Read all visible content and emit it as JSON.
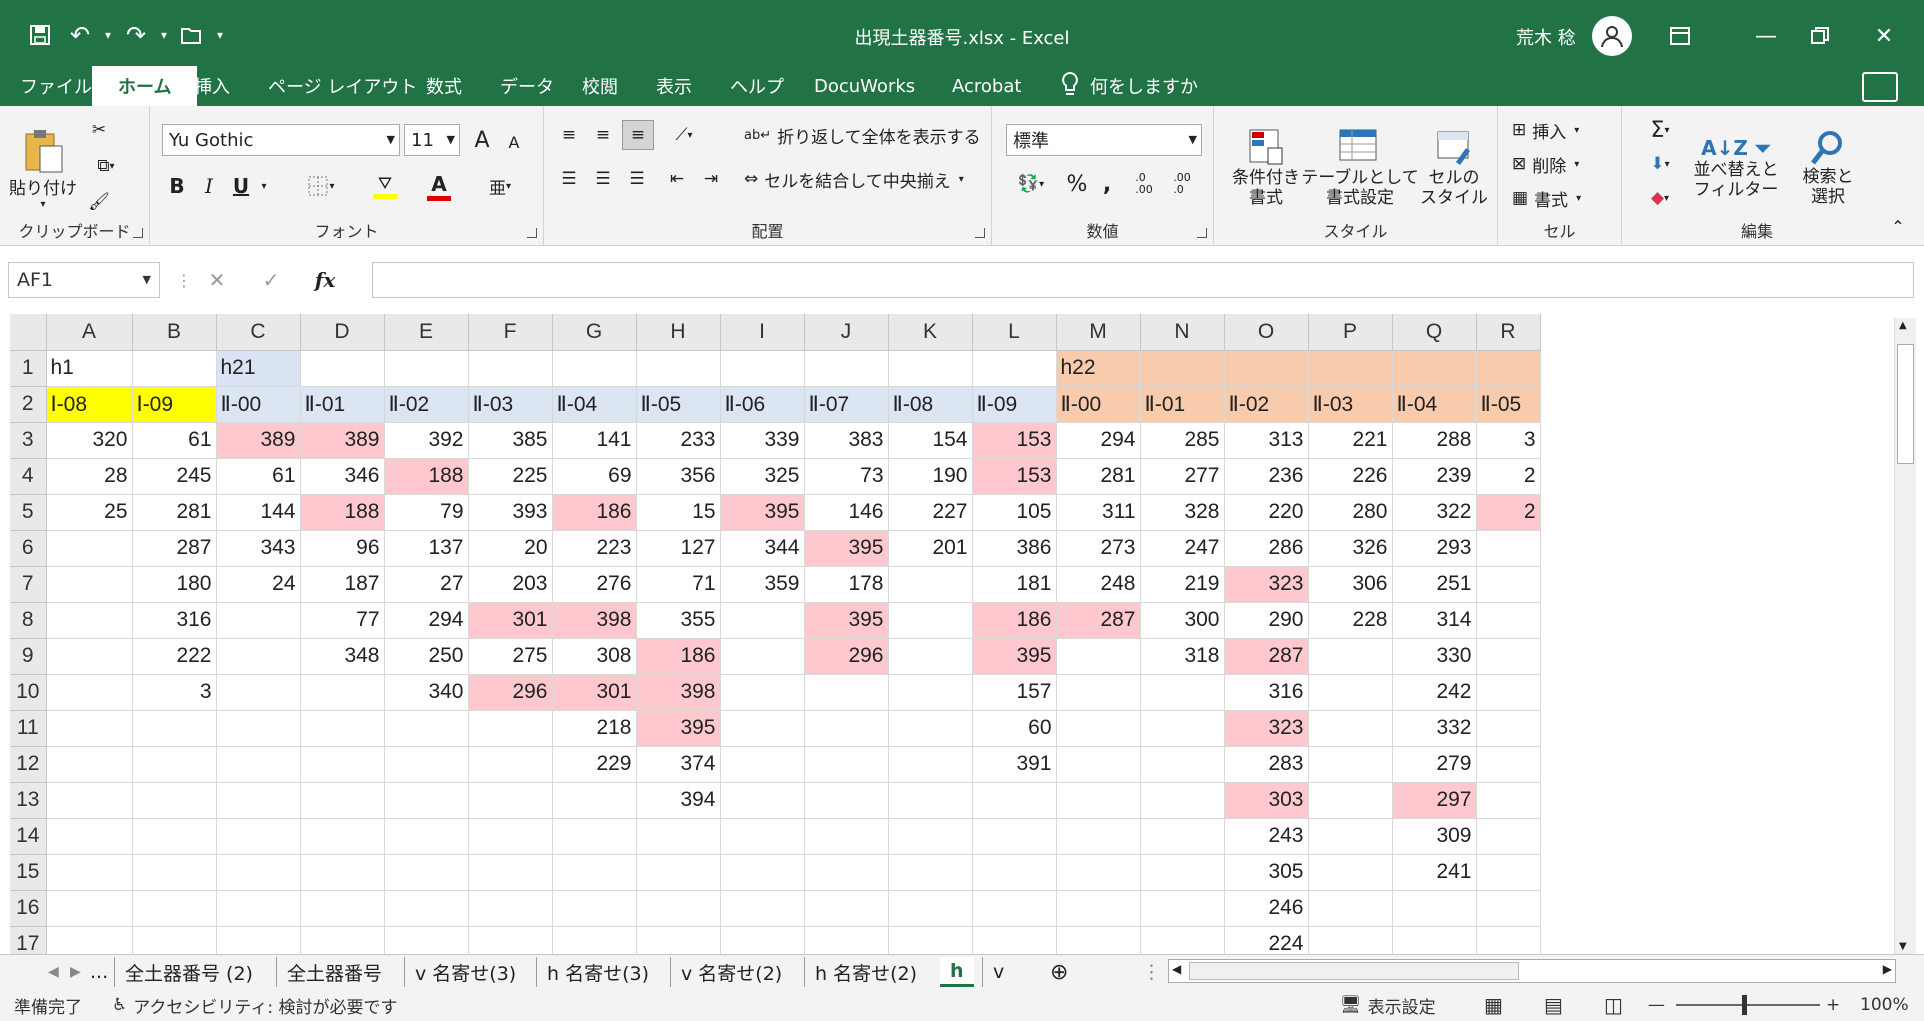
{
  "window": {
    "title": "出現土器番号.xlsx  -  Excel",
    "user": "荒木 稔"
  },
  "tabs": [
    "ファイル",
    "ホーム",
    "挿入",
    "ページ レイアウト",
    "数式",
    "データ",
    "校閲",
    "表示",
    "ヘルプ",
    "DocuWorks",
    "Acrobat"
  ],
  "tell_me": "何をしますか",
  "ribbon": {
    "clipboard": {
      "label": "クリップボード",
      "paste": "貼り付け"
    },
    "font": {
      "label": "フォント",
      "name": "Yu Gothic",
      "size": "11",
      "bold": "B",
      "italic": "I",
      "underline": "U",
      "grow": "A",
      "shrink": "A",
      "color": "A"
    },
    "alignment": {
      "label": "配置",
      "wrap": "折り返して全体を表示する",
      "merge": "セルを結合して中央揃え"
    },
    "number": {
      "label": "数値",
      "format": "標準",
      "percent": "%",
      "comma": ",",
      "inc": ".0\n.00",
      "dec": ".00\n.0"
    },
    "styles": {
      "label": "スタイル",
      "conditional": "条件付き\n書式",
      "table": "テーブルとして\n書式設定",
      "cell": "セルの\nスタイル"
    },
    "cells": {
      "label": "セル",
      "insert": "挿入",
      "delete": "削除",
      "format": "書式"
    },
    "editing": {
      "label": "編集",
      "sort": "並べ替えと\nフィルター",
      "find": "検索と\n選択",
      "sum": "Σ"
    }
  },
  "formula_bar": {
    "name_box": "AF1",
    "formula": ""
  },
  "columns": [
    "A",
    "B",
    "C",
    "D",
    "E",
    "F",
    "G",
    "H",
    "I",
    "J",
    "K",
    "L",
    "M",
    "N",
    "O",
    "P",
    "Q",
    "R"
  ],
  "rows": [
    {
      "n": "1",
      "c": [
        "h1",
        "",
        "h21",
        "",
        "",
        "",
        "",
        "",
        "",
        "",
        "",
        "",
        "h22",
        "",
        "",
        "",
        "",
        ""
      ]
    },
    {
      "n": "2",
      "c": [
        "Ⅰ-08",
        "Ⅰ-09",
        "Ⅱ-00",
        "Ⅱ-01",
        "Ⅱ-02",
        "Ⅱ-03",
        "Ⅱ-04",
        "Ⅱ-05",
        "Ⅱ-06",
        "Ⅱ-07",
        "Ⅱ-08",
        "Ⅱ-09",
        "Ⅱ-00",
        "Ⅱ-01",
        "Ⅱ-02",
        "Ⅱ-03",
        "Ⅱ-04",
        "Ⅱ-05"
      ]
    },
    {
      "n": "3",
      "c": [
        "320",
        "61",
        "389",
        "389",
        "392",
        "385",
        "141",
        "233",
        "339",
        "383",
        "154",
        "153",
        "294",
        "285",
        "313",
        "221",
        "288",
        "3"
      ]
    },
    {
      "n": "4",
      "c": [
        "28",
        "245",
        "61",
        "346",
        "188",
        "225",
        "69",
        "356",
        "325",
        "73",
        "190",
        "153",
        "281",
        "277",
        "236",
        "226",
        "239",
        "2"
      ]
    },
    {
      "n": "5",
      "c": [
        "25",
        "281",
        "144",
        "188",
        "79",
        "393",
        "186",
        "15",
        "395",
        "146",
        "227",
        "105",
        "311",
        "328",
        "220",
        "280",
        "322",
        "2"
      ]
    },
    {
      "n": "6",
      "c": [
        "",
        "287",
        "343",
        "96",
        "137",
        "20",
        "223",
        "127",
        "344",
        "395",
        "201",
        "386",
        "273",
        "247",
        "286",
        "326",
        "293",
        ""
      ]
    },
    {
      "n": "7",
      "c": [
        "",
        "180",
        "24",
        "187",
        "27",
        "203",
        "276",
        "71",
        "359",
        "178",
        "",
        "181",
        "248",
        "219",
        "323",
        "306",
        "251",
        ""
      ]
    },
    {
      "n": "8",
      "c": [
        "",
        "316",
        "",
        "77",
        "294",
        "301",
        "398",
        "355",
        "",
        "395",
        "",
        "186",
        "287",
        "300",
        "290",
        "228",
        "314",
        ""
      ]
    },
    {
      "n": "9",
      "c": [
        "",
        "222",
        "",
        "348",
        "250",
        "275",
        "308",
        "186",
        "",
        "296",
        "",
        "395",
        "",
        "318",
        "287",
        "",
        "330",
        ""
      ]
    },
    {
      "n": "10",
      "c": [
        "",
        "3",
        "",
        "",
        "340",
        "296",
        "301",
        "398",
        "",
        "",
        "",
        "157",
        "",
        "",
        "316",
        "",
        "242",
        ""
      ]
    },
    {
      "n": "11",
      "c": [
        "",
        "",
        "",
        "",
        "",
        "",
        "218",
        "395",
        "",
        "",
        "",
        "60",
        "",
        "",
        "323",
        "",
        "332",
        ""
      ]
    },
    {
      "n": "12",
      "c": [
        "",
        "",
        "",
        "",
        "",
        "",
        "229",
        "374",
        "",
        "",
        "",
        "391",
        "",
        "",
        "283",
        "",
        "279",
        ""
      ]
    },
    {
      "n": "13",
      "c": [
        "",
        "",
        "",
        "",
        "",
        "",
        "",
        "394",
        "",
        "",
        "",
        "",
        "",
        "",
        "303",
        "",
        "297",
        ""
      ]
    },
    {
      "n": "14",
      "c": [
        "",
        "",
        "",
        "",
        "",
        "",
        "",
        "",
        "",
        "",
        "",
        "",
        "",
        "",
        "243",
        "",
        "309",
        ""
      ]
    },
    {
      "n": "15",
      "c": [
        "",
        "",
        "",
        "",
        "",
        "",
        "",
        "",
        "",
        "",
        "",
        "",
        "",
        "",
        "305",
        "",
        "241",
        ""
      ]
    },
    {
      "n": "16",
      "c": [
        "",
        "",
        "",
        "",
        "",
        "",
        "",
        "",
        "",
        "",
        "",
        "",
        "",
        "",
        "246",
        "",
        "",
        ""
      ]
    },
    {
      "n": "17",
      "c": [
        "",
        "",
        "",
        "",
        "",
        "",
        "",
        "",
        "",
        "",
        "",
        "",
        "",
        "",
        "224",
        "",
        "",
        ""
      ]
    }
  ],
  "highlights": [
    "3-2",
    "3-3",
    "3-11",
    "4-4",
    "4-11",
    "5-3",
    "5-6",
    "5-8",
    "5-17",
    "6-9",
    "7-14",
    "8-5",
    "8-6",
    "8-9",
    "8-11",
    "8-12",
    "9-7",
    "9-9",
    "9-11",
    "9-14",
    "10-5",
    "10-6",
    "10-7",
    "11-7",
    "11-14",
    "13-14",
    "13-16"
  ],
  "sheets": [
    "...",
    "全土器番号 (2)",
    "全土器番号",
    "v 名寄せ(3)",
    "h 名寄せ(3)",
    "v 名寄せ(2)",
    "h 名寄せ(2)",
    "h",
    "v"
  ],
  "active_sheet": "h",
  "status": {
    "ready": "準備完了",
    "accessibility": "アクセシビリティ: 検討が必要です",
    "display_settings": "表示設定",
    "zoom": "100%"
  },
  "colors": {
    "excel_green": "#217346",
    "highlight": "#ffc7ce",
    "yellow": "#ffff00",
    "blue": "#dce6f2",
    "orange": "#f8cbad"
  }
}
